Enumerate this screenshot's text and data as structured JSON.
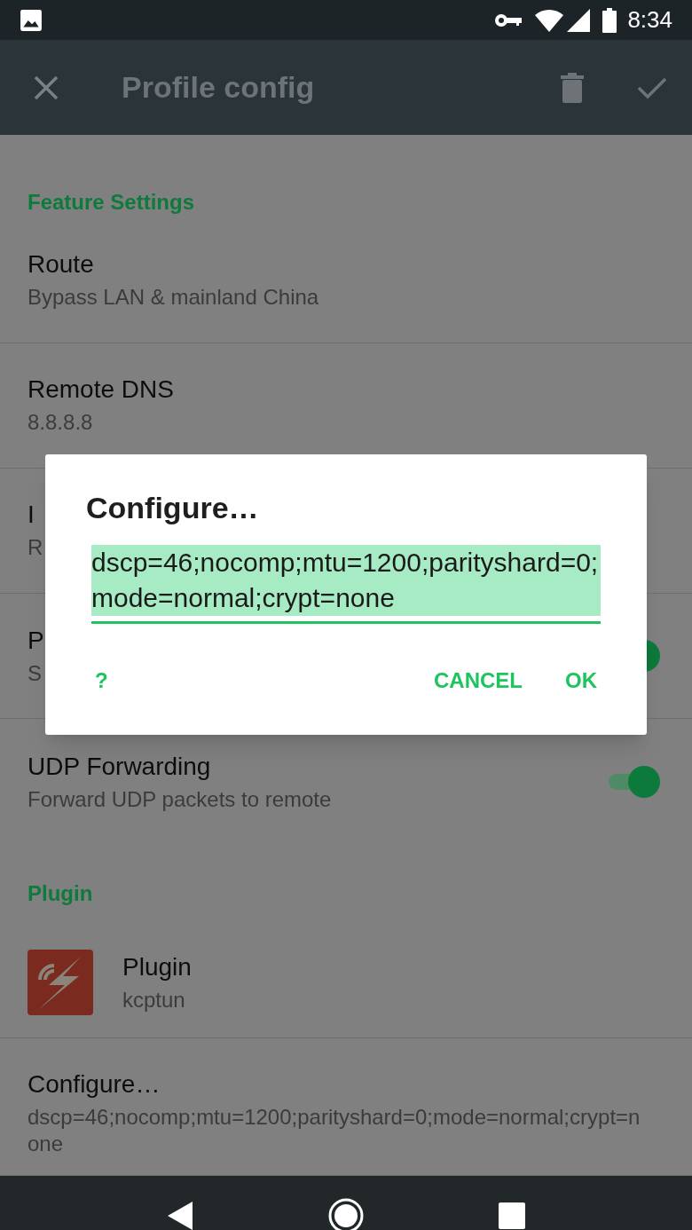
{
  "status_bar": {
    "time": "8:34"
  },
  "app_bar": {
    "title": "Profile config"
  },
  "sections": [
    {
      "header": "Feature Settings",
      "items": [
        {
          "kind": "text",
          "title": "Route",
          "summary": "Bypass LAN & mainland China"
        },
        {
          "kind": "text",
          "title": "Remote DNS",
          "summary": "8.8.8.8"
        },
        {
          "kind": "text",
          "title": "I",
          "summary": "R"
        },
        {
          "kind": "switch",
          "title": "P",
          "summary": "S",
          "on": true
        },
        {
          "kind": "switch",
          "title": "UDP Forwarding",
          "summary": "Forward UDP packets to remote",
          "on": true
        }
      ]
    },
    {
      "header": "Plugin",
      "items": [
        {
          "kind": "plugin",
          "title": "Plugin",
          "summary": "kcptun"
        },
        {
          "kind": "text",
          "title": "Configure…",
          "summary": "dscp=46;nocomp;mtu=1200;parityshard=0;mode=normal;crypt=none"
        }
      ]
    }
  ],
  "dialog": {
    "title": "Configure…",
    "value": "dscp=46;nocomp;mtu=1200;parityshard=0;mode=normal;crypt=none",
    "text_selected": true,
    "buttons": [
      {
        "label": "?"
      },
      {
        "label": "CANCEL"
      },
      {
        "label": "OK"
      }
    ]
  }
}
